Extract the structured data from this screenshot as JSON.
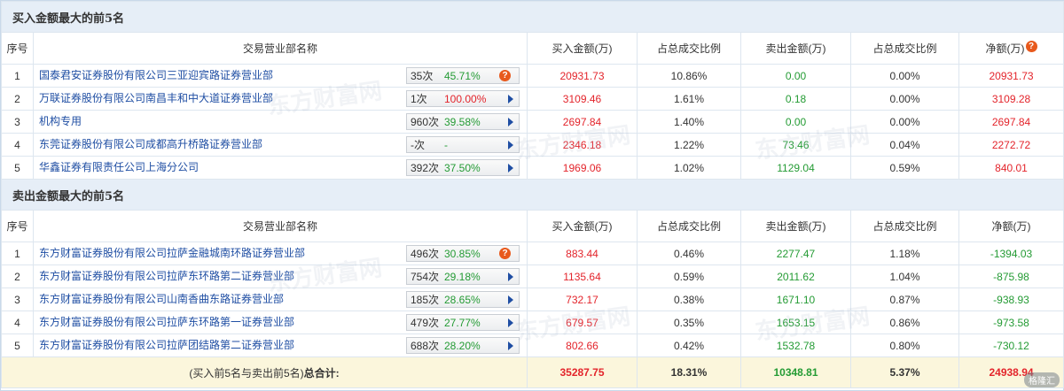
{
  "buy_section": {
    "title": "买入金额最大的前5名",
    "headers": [
      "序号",
      "交易营业部名称",
      "买入金额(万)",
      "占总成交比例",
      "卖出金额(万)",
      "占总成交比例",
      "净额(万)"
    ],
    "rows": [
      {
        "idx": "1",
        "name": "国泰君安证券股份有限公司三亚迎宾路证券营业部",
        "count": "35次",
        "pct": "45.71%",
        "pct_color": "green",
        "icon": "question",
        "buy": "20931.73",
        "buy_ratio": "10.86%",
        "sell": "0.00",
        "sell_ratio": "0.00%",
        "net": "20931.73",
        "net_color": "red"
      },
      {
        "idx": "2",
        "name": "万联证券股份有限公司南昌丰和中大道证券营业部",
        "count": "1次",
        "pct": "100.00%",
        "pct_color": "red",
        "icon": "arrow",
        "buy": "3109.46",
        "buy_ratio": "1.61%",
        "sell": "0.18",
        "sell_ratio": "0.00%",
        "net": "3109.28",
        "net_color": "red"
      },
      {
        "idx": "3",
        "name": "机构专用",
        "count": "960次",
        "pct": "39.58%",
        "pct_color": "green",
        "icon": "arrow",
        "buy": "2697.84",
        "buy_ratio": "1.40%",
        "sell": "0.00",
        "sell_ratio": "0.00%",
        "net": "2697.84",
        "net_color": "red"
      },
      {
        "idx": "4",
        "name": "东莞证券股份有限公司成都高升桥路证券营业部",
        "count": "-次",
        "pct": "-",
        "pct_color": "green",
        "icon": "arrow",
        "buy": "2346.18",
        "buy_ratio": "1.22%",
        "sell": "73.46",
        "sell_ratio": "0.04%",
        "net": "2272.72",
        "net_color": "red"
      },
      {
        "idx": "5",
        "name": "华鑫证券有限责任公司上海分公司",
        "count": "392次",
        "pct": "37.50%",
        "pct_color": "green",
        "icon": "arrow",
        "buy": "1969.06",
        "buy_ratio": "1.02%",
        "sell": "1129.04",
        "sell_ratio": "0.59%",
        "net": "840.01",
        "net_color": "red"
      }
    ]
  },
  "sell_section": {
    "title": "卖出金额最大的前5名",
    "headers": [
      "序号",
      "交易营业部名称",
      "买入金额(万)",
      "占总成交比例",
      "卖出金额(万)",
      "占总成交比例",
      "净额(万)"
    ],
    "rows": [
      {
        "idx": "1",
        "name": "东方财富证券股份有限公司拉萨金融城南环路证券营业部",
        "count": "496次",
        "pct": "30.85%",
        "pct_color": "green",
        "icon": "question",
        "buy": "883.44",
        "buy_ratio": "0.46%",
        "sell": "2277.47",
        "sell_ratio": "1.18%",
        "net": "-1394.03",
        "net_color": "green"
      },
      {
        "idx": "2",
        "name": "东方财富证券股份有限公司拉萨东环路第二证券营业部",
        "count": "754次",
        "pct": "29.18%",
        "pct_color": "green",
        "icon": "arrow",
        "buy": "1135.64",
        "buy_ratio": "0.59%",
        "sell": "2011.62",
        "sell_ratio": "1.04%",
        "net": "-875.98",
        "net_color": "green"
      },
      {
        "idx": "3",
        "name": "东方财富证券股份有限公司山南香曲东路证券营业部",
        "count": "185次",
        "pct": "28.65%",
        "pct_color": "green",
        "icon": "arrow",
        "buy": "732.17",
        "buy_ratio": "0.38%",
        "sell": "1671.10",
        "sell_ratio": "0.87%",
        "net": "-938.93",
        "net_color": "green"
      },
      {
        "idx": "4",
        "name": "东方财富证券股份有限公司拉萨东环路第一证券营业部",
        "count": "479次",
        "pct": "27.77%",
        "pct_color": "green",
        "icon": "arrow",
        "buy": "679.57",
        "buy_ratio": "0.35%",
        "sell": "1653.15",
        "sell_ratio": "0.86%",
        "net": "-973.58",
        "net_color": "green"
      },
      {
        "idx": "5",
        "name": "东方财富证券股份有限公司拉萨团结路第二证券营业部",
        "count": "688次",
        "pct": "28.20%",
        "pct_color": "green",
        "icon": "arrow",
        "buy": "802.66",
        "buy_ratio": "0.42%",
        "sell": "1532.78",
        "sell_ratio": "0.80%",
        "net": "-730.12",
        "net_color": "green"
      }
    ]
  },
  "total": {
    "label_prefix": "(买入前5名与卖出前5名)",
    "label_bold": "总合计:",
    "buy": "35287.75",
    "buy_ratio": "18.31%",
    "sell": "10348.81",
    "sell_ratio": "5.37%",
    "net": "24938.94"
  },
  "watermark_text": "东方财富网",
  "watermark_sub": "eastmoney.com",
  "corner_badge": "格隆汇",
  "colors": {
    "red": "#e3242b",
    "green": "#249b34",
    "link": "#1f4ea3",
    "section_bg": "#e6eef7",
    "total_bg": "#fbf6dc"
  }
}
